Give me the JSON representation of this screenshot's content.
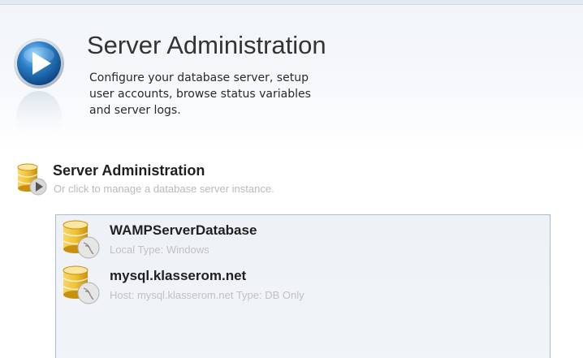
{
  "header": {
    "title": "Server Administration",
    "description_lines": [
      "Configure your database server, setup",
      "user accounts, browse status variables",
      "and server logs."
    ],
    "icon": "play-circle-icon"
  },
  "section": {
    "title": "Server Administration",
    "subtitle": "Or click to manage a database server instance.",
    "icon": "database-play-icon"
  },
  "instances": [
    {
      "name": "WAMPServerDatabase",
      "details": "Local  Type: Windows",
      "icon": "database-dolphin-icon"
    },
    {
      "name": "mysql.klasserom.net",
      "details": "Host: mysql.klasserom.net  Type: DB Only",
      "icon": "database-dolphin-icon"
    }
  ],
  "colors": {
    "accent_blue": "#2a7fc8",
    "database_gold": "#e8b420",
    "list_border": "#a9bccf",
    "muted_text": "#c0c0c0"
  }
}
